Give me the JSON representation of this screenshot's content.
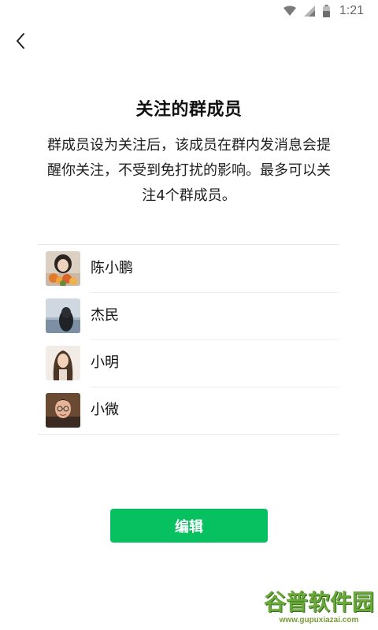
{
  "status_bar": {
    "time": "1:21",
    "icons": [
      "wifi-icon",
      "signal-icon",
      "battery-icon"
    ]
  },
  "header": {
    "back_icon": "back-arrow-icon"
  },
  "title": "关注的群成员",
  "description": "群成员设为关注后，该成员在群内发消息会提醒你关注，不受到免打扰的影响。最多可以关注4个群成员。",
  "members": [
    {
      "name": "陈小鹏",
      "avatar": "avatar-woman-with-flowers"
    },
    {
      "name": "杰民",
      "avatar": "avatar-person-by-sea"
    },
    {
      "name": "小明",
      "avatar": "avatar-woman-long-hair"
    },
    {
      "name": "小微",
      "avatar": "avatar-man-glasses"
    }
  ],
  "edit_button": "编辑",
  "watermark": {
    "logo": "谷普软件园",
    "url": "www.gupuxiazai.com"
  },
  "colors": {
    "accent": "#07c160",
    "divider": "#e8e8e8",
    "text": "#111111"
  }
}
